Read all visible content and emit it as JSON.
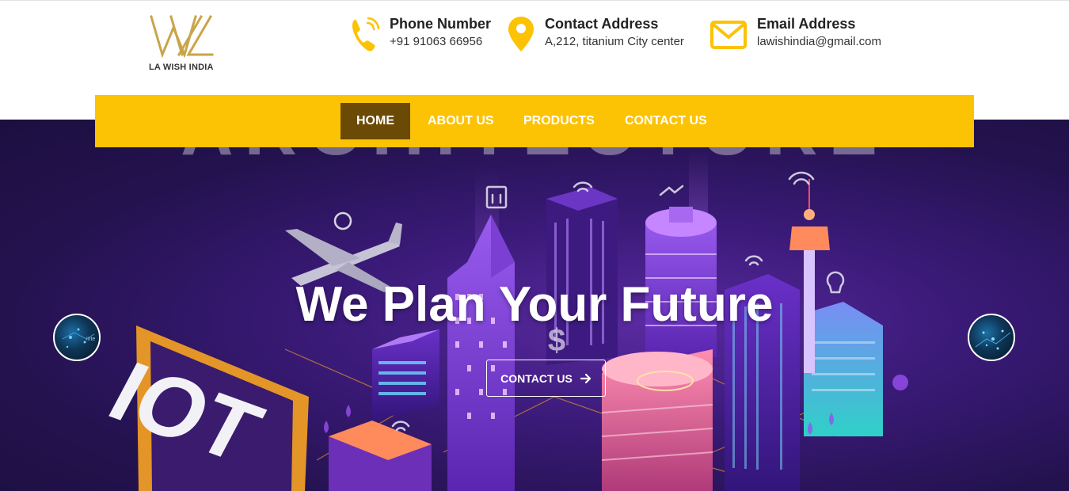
{
  "brand": {
    "name": "LA WISH INDIA",
    "accent": "#fcc204",
    "logo_color": "#c9a54a"
  },
  "contacts": [
    {
      "icon": "phone-icon",
      "title": "Phone Number",
      "value": "+91 91063 66956"
    },
    {
      "icon": "location-pin-icon",
      "title": "Contact Address",
      "value": "A,212, titanium City center"
    },
    {
      "icon": "envelope-icon",
      "title": "Email Address",
      "value": "lawishindia@gmail.com"
    }
  ],
  "nav": {
    "items": [
      {
        "label": "HOME",
        "active": true
      },
      {
        "label": "ABOUT US",
        "active": false
      },
      {
        "label": "PRODUCTS",
        "active": false
      },
      {
        "label": "CONTACT US",
        "active": false
      }
    ],
    "active_color": "#6b4a05"
  },
  "hero": {
    "title": "We Plan Your Future",
    "cta_label": "CONTACT US",
    "background_text_top": "ARCHITECTURE",
    "background_text_sign": "IOT",
    "background_symbol": "$"
  },
  "slider": {
    "prev_label": "previous-slide",
    "next_label": "next-slide",
    "thumb_text": "inte"
  }
}
